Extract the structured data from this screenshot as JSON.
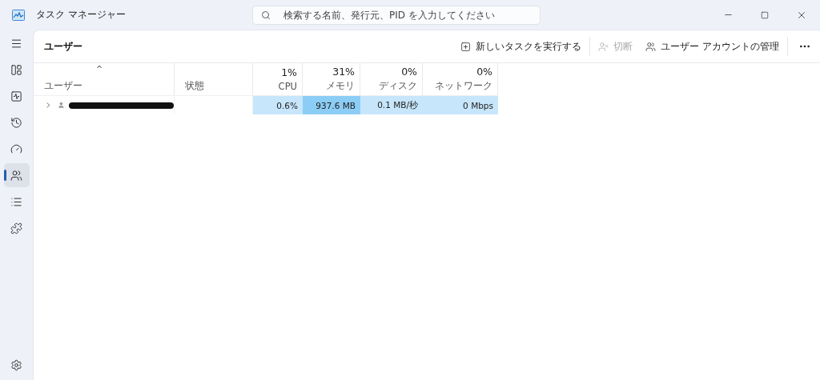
{
  "window": {
    "title": "タスク マネージャー"
  },
  "search": {
    "placeholder": "検索する名前、発行元、PID を入力してください"
  },
  "sidebar": {
    "items": [
      {
        "kind": "menu",
        "selected": false
      },
      {
        "kind": "processes",
        "selected": false
      },
      {
        "kind": "performance",
        "selected": false
      },
      {
        "kind": "history",
        "selected": false
      },
      {
        "kind": "startup",
        "selected": false
      },
      {
        "kind": "users",
        "selected": true
      },
      {
        "kind": "details",
        "selected": false
      },
      {
        "kind": "services",
        "selected": false
      }
    ],
    "bottom": {
      "kind": "settings",
      "selected": false
    }
  },
  "page": {
    "title": "ユーザー"
  },
  "toolbar": [
    {
      "kind": "new-task",
      "label": "新しいタスクを実行する",
      "disabled": false
    },
    {
      "kind": "disconnect",
      "label": "切断",
      "disabled": true
    },
    {
      "kind": "accounts",
      "label": "ユーザー アカウントの管理",
      "disabled": false
    }
  ],
  "table": {
    "sort_caret": "^",
    "columns": [
      {
        "kind": "text",
        "label": "ユーザー"
      },
      {
        "kind": "text",
        "label": "状態"
      },
      {
        "kind": "metric",
        "percent": "1%",
        "label": "CPU"
      },
      {
        "kind": "metric",
        "percent": "31%",
        "label": "メモリ"
      },
      {
        "kind": "metric",
        "percent": "0%",
        "label": "ディスク"
      },
      {
        "kind": "metric",
        "percent": "0%",
        "label": "ネットワーク"
      }
    ],
    "rows": [
      {
        "cells": [
          {
            "kind": "user",
            "expanded": false,
            "redacted": true
          },
          {
            "kind": "text"
          },
          {
            "value": "0.6%",
            "color": "#c7e6fb"
          },
          {
            "value": "937.6 MB",
            "color": "#8ccdf6"
          },
          {
            "value": "0.1 MB/秒",
            "color": "#c7e6fb"
          },
          {
            "value": "0 Mbps",
            "color": "#c7e6fb"
          }
        ]
      }
    ]
  }
}
